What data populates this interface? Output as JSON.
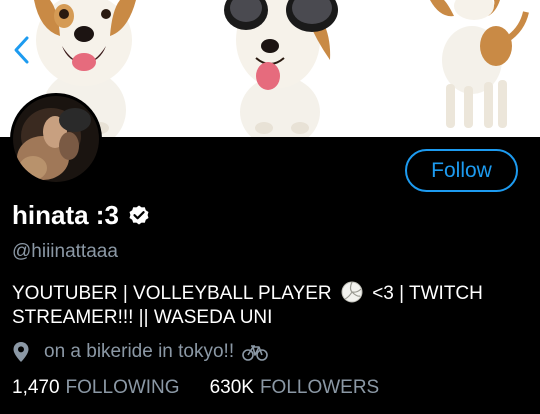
{
  "profile": {
    "display_name": "hinata :3",
    "handle": "@hiiinattaaa",
    "bio_line1_a": "YOUTUBER | VOLLEYBALL PLAYER",
    "bio_line1_b": "<3 | TWITCH",
    "bio_line2": "STREAMER!!! || WASEDA UNI",
    "location": "on a bikeride in tokyo!!",
    "verified": true
  },
  "actions": {
    "follow_label": "Follow"
  },
  "stats": {
    "following_count": "1,470",
    "following_label": "FOLLOWING",
    "followers_count": "630K",
    "followers_label": "FOLLOWERS"
  },
  "icons": {
    "back": "chevron-left-icon",
    "verified": "verified-badge-icon",
    "volleyball": "volleyball-emoji",
    "location": "location-pin-icon",
    "bike": "bicycle-emoji"
  },
  "colors": {
    "accent": "#1d9bf0",
    "background": "#000000",
    "secondary_text": "#8b98a5"
  }
}
